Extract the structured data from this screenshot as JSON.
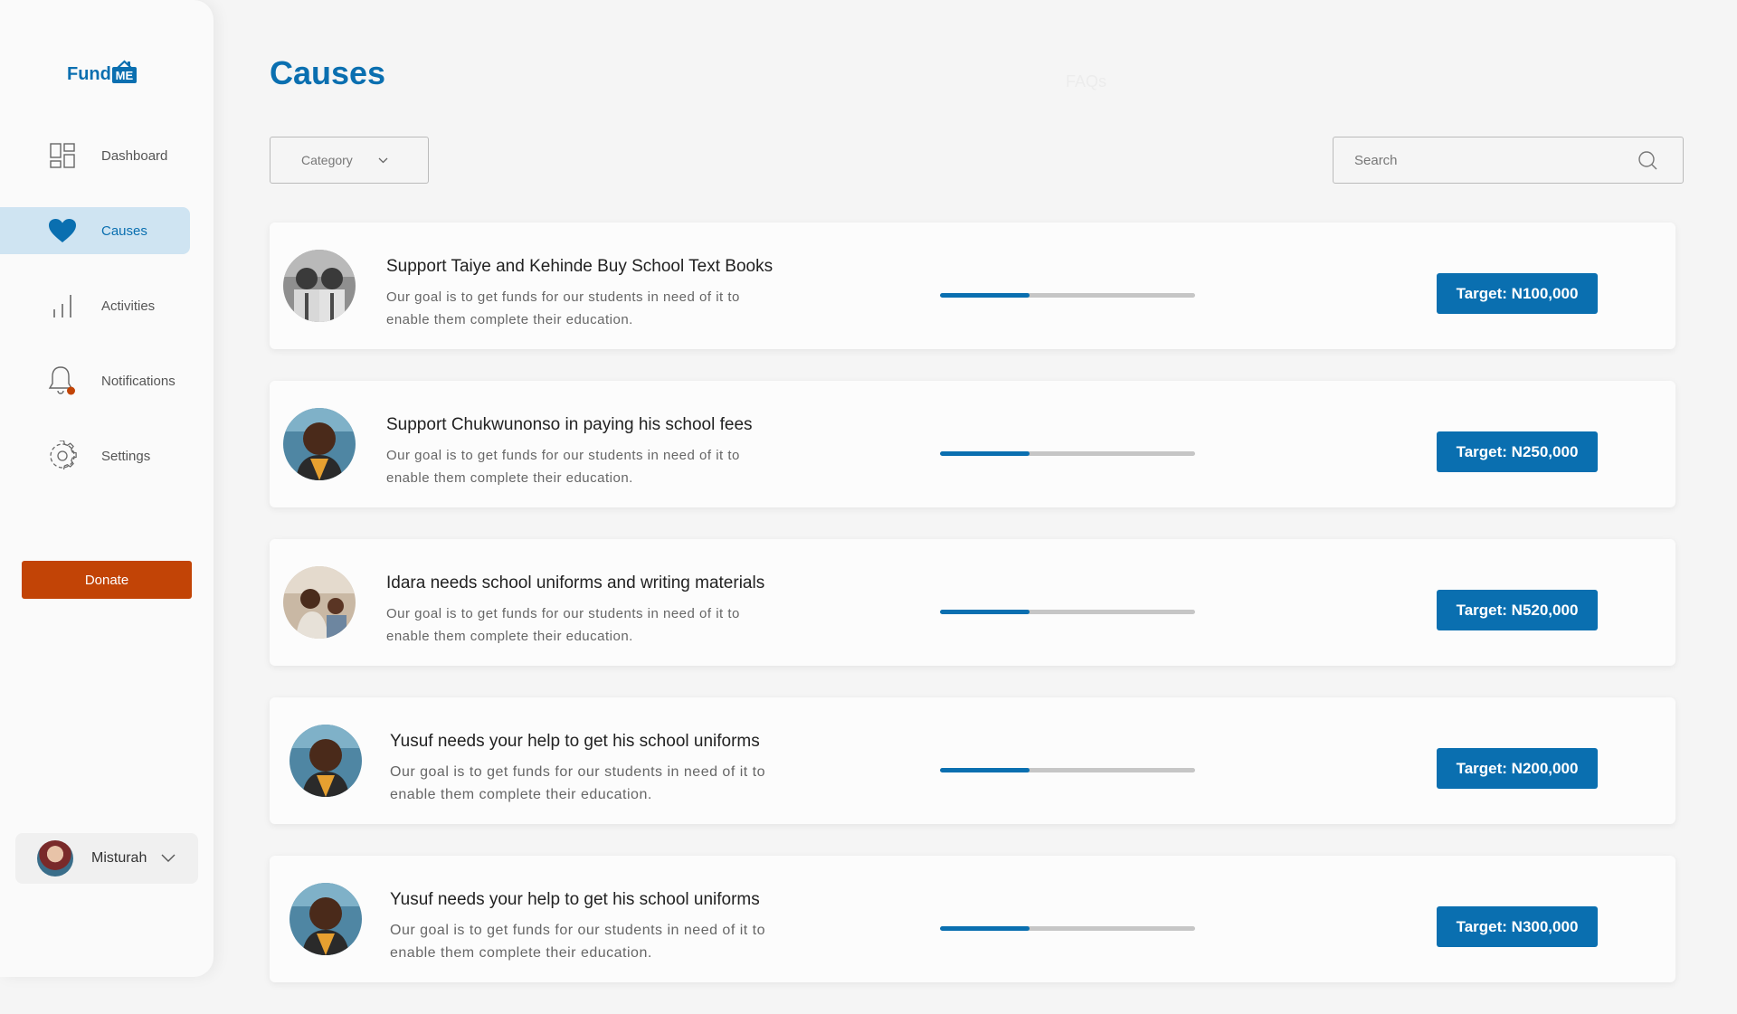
{
  "app": {
    "logo_text": "Fund",
    "logo_badge": "ME"
  },
  "sidebar": {
    "items": [
      {
        "label": "Dashboard",
        "icon": "dashboard-icon",
        "active": false
      },
      {
        "label": "Causes",
        "icon": "heart-icon",
        "active": true
      },
      {
        "label": "Activities",
        "icon": "bar-chart-icon",
        "active": false
      },
      {
        "label": "Notifications",
        "icon": "bell-icon",
        "active": false
      },
      {
        "label": "Settings",
        "icon": "gear-icon",
        "active": false
      }
    ],
    "donate_label": "Donate",
    "user": {
      "name": "Misturah"
    }
  },
  "header": {
    "title": "Causes",
    "faq_label": "FAQs"
  },
  "filters": {
    "category_label": "Category",
    "search_placeholder": "Search"
  },
  "causes": [
    {
      "title": "Support Taiye and Kehinde Buy School Text Books",
      "description": "Our goal is to get funds for our students in need of it to enable them complete their education.",
      "progress": 0.35,
      "target": "Target: N100,000"
    },
    {
      "title": "Support Chukwunonso in paying his school fees",
      "description": "Our goal is to get funds for our students in need of it to enable them complete their education.",
      "progress": 0.35,
      "target": "Target: N250,000"
    },
    {
      "title": "Idara needs school uniforms and writing materials",
      "description": "Our goal is to get funds for our students in need of it to enable them complete their education.",
      "progress": 0.35,
      "target": "Target: N520,000"
    },
    {
      "title": "Yusuf needs your help to get his school uniforms",
      "description": "Our goal is to get funds for our students in need of it to enable them complete their education.",
      "progress": 0.35,
      "target": "Target: N200,000"
    },
    {
      "title": "Yusuf needs your help to get his school uniforms",
      "description": "Our goal is to get funds for our students in need of it to enable them complete their education.",
      "progress": 0.35,
      "target": "Target: N300,000"
    }
  ],
  "colors": {
    "accent": "#0a6fb0",
    "donate": "#c24406",
    "active_nav_bg": "#cfe4f2",
    "progress_track": "#c6c6c6"
  }
}
